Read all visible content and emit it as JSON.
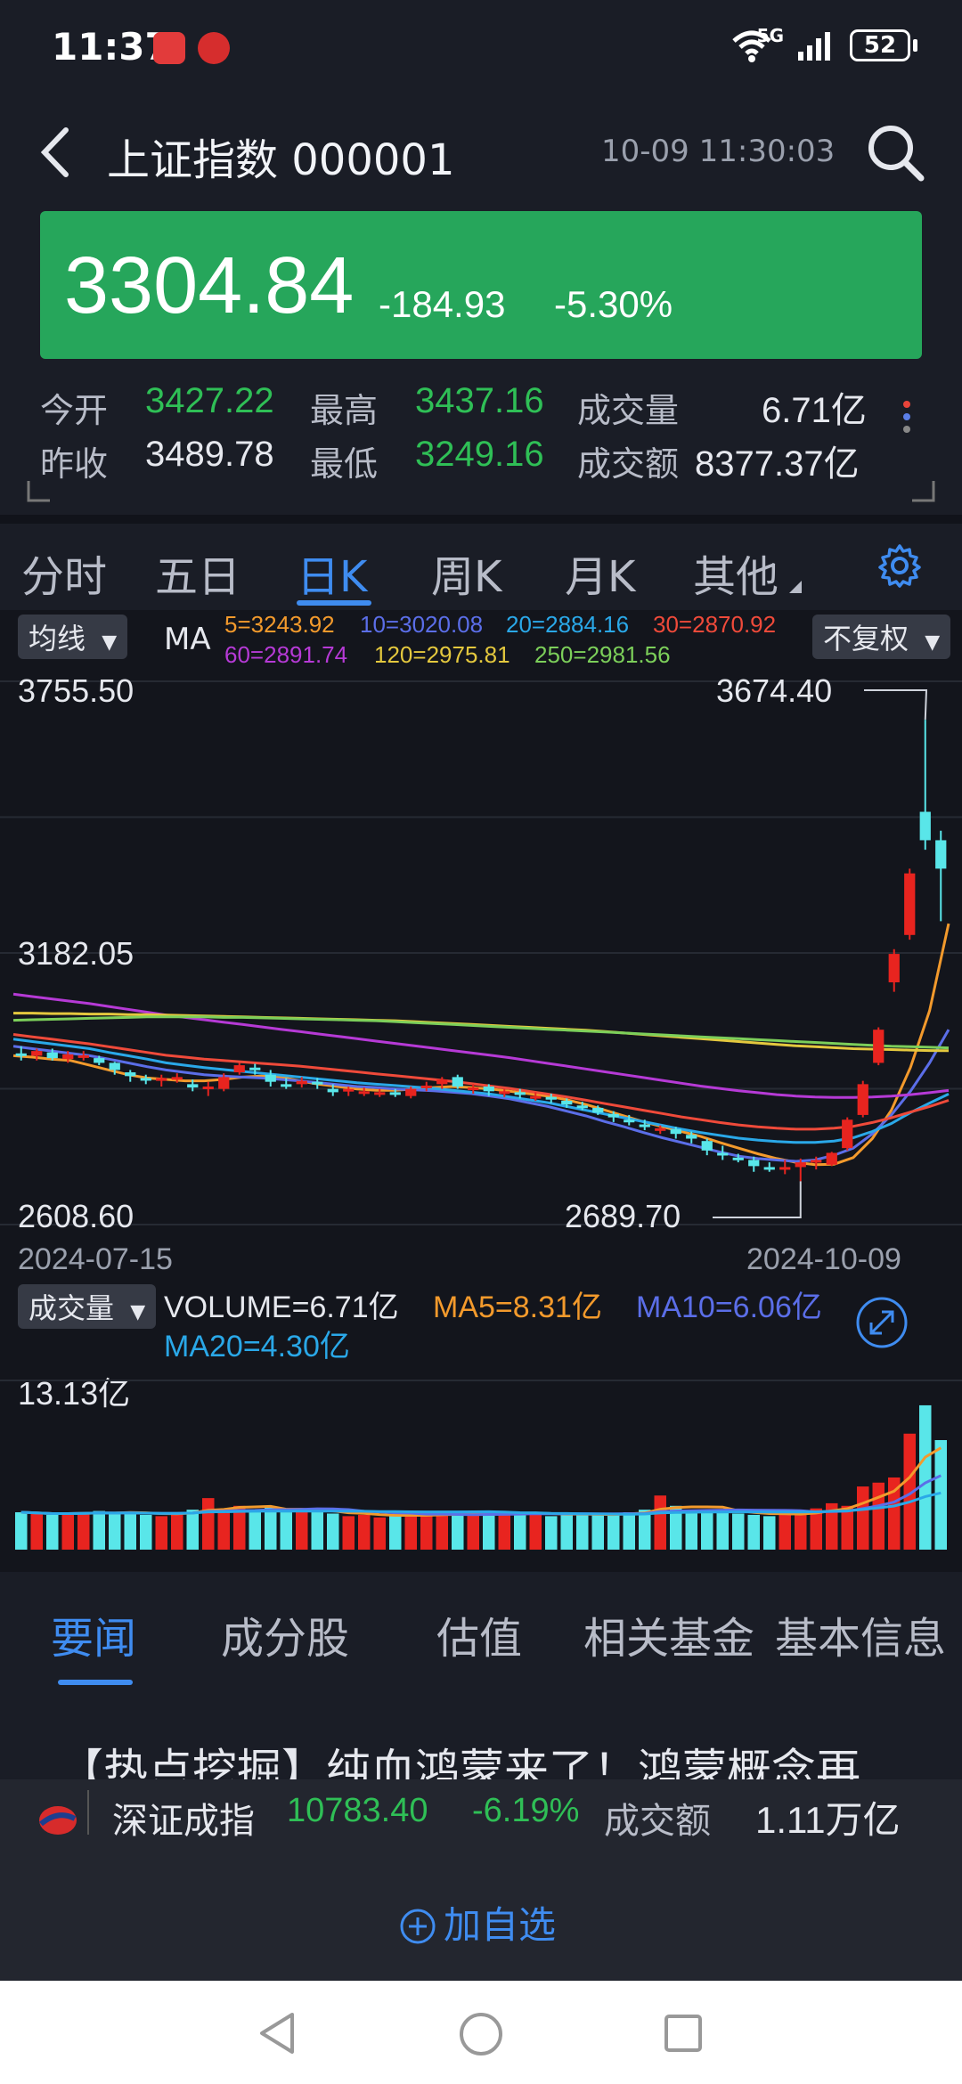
{
  "status_bar": {
    "time": "11:37",
    "battery": "52",
    "network": "5G"
  },
  "header": {
    "title": "上证指数 000001",
    "datetime": "10-09 11:30:03"
  },
  "quote": {
    "price": "3304.84",
    "change": "-184.93",
    "change_pct": "-5.30%"
  },
  "stats": {
    "open_label": "今开",
    "open": "3427.22",
    "high_label": "最高",
    "high": "3437.16",
    "volume_label": "成交量",
    "volume": "6.71亿",
    "prev_label": "昨收",
    "prev": "3489.78",
    "low_label": "最低",
    "low": "3249.16",
    "amount_label": "成交额",
    "amount": "8377.37亿"
  },
  "period_tabs": [
    "分时",
    "五日",
    "日K",
    "周K",
    "月K",
    "其他"
  ],
  "active_tab": "日K",
  "chart_controls": {
    "ma_select": "均线",
    "ma_prefix": "MA",
    "fq_select": "不复权",
    "vol_select": "成交量"
  },
  "ma_legend": [
    {
      "text": "5=3243.92",
      "color": "#f39a2c"
    },
    {
      "text": "10=3020.08",
      "color": "#5b6ee8"
    },
    {
      "text": "20=2884.16",
      "color": "#2aa8e8"
    },
    {
      "text": "30=2870.92",
      "color": "#ef4a3a"
    },
    {
      "text": "60=2891.74",
      "color": "#b63ad6"
    },
    {
      "text": "120=2975.81",
      "color": "#e4c83e"
    },
    {
      "text": "250=2981.56",
      "color": "#7ccf5a"
    }
  ],
  "chart_data": {
    "type": "candlestick",
    "x_start": "2024-07-15",
    "x_end": "2024-10-09",
    "y_ticks": [
      "3755.50",
      "3182.05",
      "2608.60"
    ],
    "ylim": [
      2608.6,
      3755.5
    ],
    "annotations": {
      "max": "3674.40",
      "min": "2689.70"
    },
    "candles": [
      [
        2970,
        2965,
        2985,
        2955
      ],
      [
        2965,
        2975,
        2980,
        2955
      ],
      [
        2972,
        2960,
        2980,
        2955
      ],
      [
        2958,
        2968,
        2975,
        2950
      ],
      [
        2962,
        2966,
        2975,
        2955
      ],
      [
        2960,
        2950,
        2965,
        2945
      ],
      [
        2950,
        2935,
        2952,
        2925
      ],
      [
        2930,
        2922,
        2935,
        2910
      ],
      [
        2918,
        2915,
        2925,
        2905
      ],
      [
        2912,
        2918,
        2925,
        2900
      ],
      [
        2915,
        2920,
        2928,
        2908
      ],
      [
        2905,
        2898,
        2915,
        2890
      ],
      [
        2895,
        2900,
        2910,
        2880
      ],
      [
        2895,
        2920,
        2928,
        2890
      ],
      [
        2930,
        2945,
        2950,
        2925
      ],
      [
        2940,
        2935,
        2948,
        2925
      ],
      [
        2925,
        2910,
        2935,
        2900
      ],
      [
        2905,
        2900,
        2918,
        2895
      ],
      [
        2905,
        2912,
        2920,
        2898
      ],
      [
        2910,
        2905,
        2918,
        2895
      ],
      [
        2895,
        2888,
        2905,
        2880
      ],
      [
        2890,
        2895,
        2900,
        2880
      ],
      [
        2890,
        2890,
        2898,
        2880
      ],
      [
        2885,
        2888,
        2895,
        2878
      ],
      [
        2888,
        2885,
        2895,
        2878
      ],
      [
        2880,
        2895,
        2900,
        2875
      ],
      [
        2900,
        2902,
        2910,
        2890
      ],
      [
        2905,
        2915,
        2920,
        2895
      ],
      [
        2920,
        2900,
        2925,
        2895
      ],
      [
        2895,
        2898,
        2905,
        2885
      ],
      [
        2900,
        2890,
        2905,
        2880
      ],
      [
        2885,
        2890,
        2895,
        2878
      ],
      [
        2888,
        2885,
        2895,
        2875
      ],
      [
        2880,
        2880,
        2888,
        2870
      ],
      [
        2878,
        2875,
        2885,
        2865
      ],
      [
        2870,
        2862,
        2875,
        2855
      ],
      [
        2860,
        2858,
        2868,
        2850
      ],
      [
        2855,
        2845,
        2860,
        2840
      ],
      [
        2842,
        2835,
        2848,
        2825
      ],
      [
        2830,
        2825,
        2840,
        2818
      ],
      [
        2820,
        2815,
        2830,
        2808
      ],
      [
        2810,
        2812,
        2818,
        2800
      ],
      [
        2810,
        2800,
        2815,
        2790
      ],
      [
        2798,
        2790,
        2805,
        2780
      ],
      [
        2785,
        2765,
        2790,
        2755
      ],
      [
        2760,
        2755,
        2775,
        2745
      ],
      [
        2750,
        2748,
        2758,
        2740
      ],
      [
        2745,
        2732,
        2752,
        2720
      ],
      [
        2730,
        2728,
        2740,
        2720
      ],
      [
        2725,
        2730,
        2745,
        2715
      ],
      [
        2730,
        2740,
        2748,
        2700
      ],
      [
        2740,
        2745,
        2752,
        2725
      ],
      [
        2735,
        2760,
        2762,
        2732
      ],
      [
        2770,
        2830,
        2835,
        2765
      ],
      [
        2840,
        2905,
        2912,
        2835
      ],
      [
        2950,
        3020,
        3025,
        2945
      ],
      [
        3120,
        3180,
        3190,
        3100
      ],
      [
        3220,
        3350,
        3360,
        3210
      ],
      [
        3480,
        3420,
        3674.4,
        3400
      ],
      [
        3420,
        3360,
        3440,
        3249
      ]
    ],
    "volume": {
      "label": "VOLUME=6.71亿",
      "ma5": "MA5=8.31亿",
      "ma10": "MA10=6.06亿",
      "ma20": "MA20=4.30亿",
      "max_tick": "13.13亿",
      "max": 13.13,
      "values": [
        2.9,
        2.8,
        2.7,
        2.8,
        2.9,
        3.0,
        2.8,
        2.9,
        2.7,
        2.6,
        2.9,
        3.1,
        4.0,
        3.0,
        3.4,
        3.1,
        3.3,
        2.9,
        3.0,
        3.0,
        2.8,
        2.6,
        2.7,
        2.5,
        2.7,
        2.8,
        2.6,
        2.9,
        2.7,
        2.8,
        3.0,
        2.7,
        2.9,
        2.8,
        2.6,
        2.8,
        2.7,
        2.8,
        2.7,
        2.9,
        3.1,
        4.2,
        3.4,
        3.0,
        2.9,
        3.0,
        2.8,
        2.7,
        2.6,
        2.8,
        2.9,
        3.2,
        3.6,
        3.4,
        4.9,
        5.2,
        5.6,
        9.0,
        11.2,
        8.5
      ]
    },
    "ma_lines": {
      "ma5": [
        2965,
        2962,
        2958,
        2955,
        2945,
        2935,
        2925,
        2918,
        2915,
        2912,
        2912,
        2915,
        2920,
        2922,
        2920,
        2912,
        2905,
        2900,
        2895,
        2892,
        2892,
        2895,
        2898,
        2900,
        2898,
        2895,
        2890,
        2885,
        2880,
        2872,
        2862,
        2850,
        2838,
        2826,
        2815,
        2805,
        2795,
        2782,
        2770,
        2758,
        2748,
        2740,
        2735,
        2736,
        2750,
        2790,
        2850,
        2940,
        3060,
        3243.92
      ],
      "ma10": [
        2985,
        2980,
        2975,
        2970,
        2965,
        2958,
        2950,
        2942,
        2935,
        2930,
        2925,
        2922,
        2920,
        2918,
        2915,
        2912,
        2908,
        2904,
        2900,
        2898,
        2895,
        2893,
        2891,
        2888,
        2885,
        2880,
        2874,
        2866,
        2858,
        2848,
        2838,
        2826,
        2815,
        2803,
        2792,
        2782,
        2772,
        2762,
        2753,
        2748,
        2745,
        2742,
        2745,
        2755,
        2770,
        2800,
        2840,
        2890,
        2950,
        3020.08
      ],
      "ma20": [
        3000,
        2995,
        2990,
        2985,
        2980,
        2972,
        2965,
        2958,
        2950,
        2945,
        2940,
        2936,
        2932,
        2928,
        2924,
        2920,
        2916,
        2912,
        2908,
        2905,
        2902,
        2899,
        2896,
        2892,
        2888,
        2884,
        2878,
        2872,
        2866,
        2858,
        2850,
        2842,
        2834,
        2826,
        2818,
        2810,
        2803,
        2797,
        2791,
        2787,
        2784,
        2782,
        2782,
        2785,
        2792,
        2805,
        2822,
        2845,
        2865,
        2884.16
      ],
      "ma30": [
        3010,
        3005,
        3000,
        2995,
        2990,
        2984,
        2978,
        2972,
        2966,
        2962,
        2958,
        2955,
        2952,
        2949,
        2946,
        2943,
        2939,
        2935,
        2931,
        2927,
        2923,
        2919,
        2915,
        2911,
        2906,
        2901,
        2896,
        2890,
        2884,
        2878,
        2871,
        2864,
        2857,
        2850,
        2843,
        2836,
        2830,
        2824,
        2819,
        2815,
        2812,
        2810,
        2810,
        2812,
        2816,
        2824,
        2834,
        2846,
        2858,
        2870.92
      ],
      "ma60": [
        3095,
        3090,
        3085,
        3080,
        3075,
        3069,
        3063,
        3057,
        3051,
        3046,
        3041,
        3036,
        3031,
        3026,
        3021,
        3016,
        3011,
        3006,
        3001,
        2996,
        2991,
        2986,
        2981,
        2976,
        2971,
        2966,
        2961,
        2955,
        2949,
        2943,
        2937,
        2931,
        2925,
        2919,
        2913,
        2907,
        2901,
        2896,
        2891,
        2887,
        2883,
        2880,
        2878,
        2877,
        2877,
        2878,
        2880,
        2883,
        2887,
        2891.74
      ],
      "ma120": [
        3055,
        3055,
        3054,
        3054,
        3053,
        3053,
        3052,
        3052,
        3051,
        3050,
        3049,
        3048,
        3047,
        3046,
        3045,
        3044,
        3043,
        3042,
        3041,
        3040,
        3039,
        3037,
        3035,
        3033,
        3031,
        3029,
        3027,
        3025,
        3023,
        3021,
        3019,
        3016,
        3013,
        3010,
        3007,
        3004,
        3001,
        2998,
        2995,
        2992,
        2989,
        2986,
        2984,
        2982,
        2980,
        2979,
        2978,
        2977,
        2976,
        2975.81
      ],
      "ma250": [
        3040,
        3041,
        3042,
        3043,
        3044,
        3045,
        3046,
        3047,
        3047,
        3047,
        3047,
        3046,
        3046,
        3045,
        3044,
        3043,
        3042,
        3041,
        3040,
        3039,
        3037,
        3035,
        3033,
        3031,
        3029,
        3027,
        3025,
        3023,
        3021,
        3019,
        3017,
        3015,
        3013,
        3011,
        3009,
        3007,
        3005,
        3003,
        3001,
        2999,
        2997,
        2995,
        2993,
        2991,
        2989,
        2987,
        2985,
        2984,
        2983,
        2981.56
      ]
    }
  },
  "bottom_tabs": [
    "要闻",
    "成分股",
    "估值",
    "相关基金",
    "基本信息"
  ],
  "news_title": "【热点挖掘】纯血鸿蒙来了！鸿蒙概念再",
  "ticker": {
    "name": "深证成指",
    "price": "10783.40",
    "pct": "-6.19%",
    "amount_label": "成交额",
    "amount": "1.11万亿"
  },
  "add_watch": "加自选",
  "colors": {
    "up": "#e8241f",
    "down": "#59e6e9",
    "accent": "#3f8cf0",
    "green_box": "#26a65b"
  }
}
